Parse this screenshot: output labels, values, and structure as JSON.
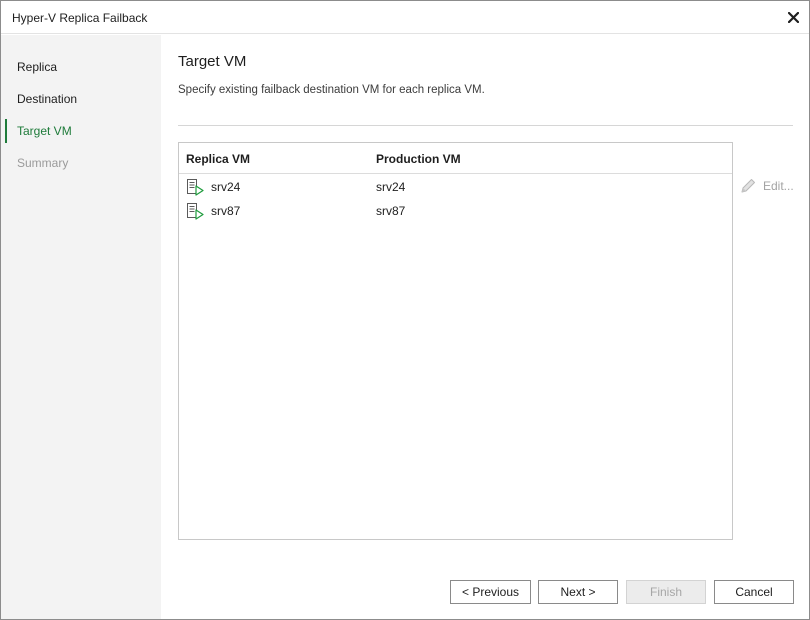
{
  "window": {
    "title": "Hyper-V Replica Failback"
  },
  "sidebar": {
    "items": [
      {
        "label": "Replica",
        "state": "normal"
      },
      {
        "label": "Destination",
        "state": "normal"
      },
      {
        "label": "Target VM",
        "state": "active"
      },
      {
        "label": "Summary",
        "state": "disabled"
      }
    ]
  },
  "main": {
    "title": "Target VM",
    "description": "Specify existing failback destination VM for each replica VM.",
    "table": {
      "columns": [
        "Replica VM",
        "Production VM"
      ],
      "rows": [
        {
          "icon": "vm-replica-icon",
          "replica": "srv24",
          "production": "srv24"
        },
        {
          "icon": "vm-replica-icon",
          "replica": "srv87",
          "production": "srv87"
        }
      ]
    },
    "edit_label": "Edit..."
  },
  "buttons": {
    "previous": "< Previous",
    "next": "Next >",
    "finish": "Finish",
    "cancel": "Cancel"
  },
  "colors": {
    "accent": "#1e7b3a",
    "sidebar_bg": "#f3f3f3",
    "disabled_text": "#9a9a9a"
  }
}
